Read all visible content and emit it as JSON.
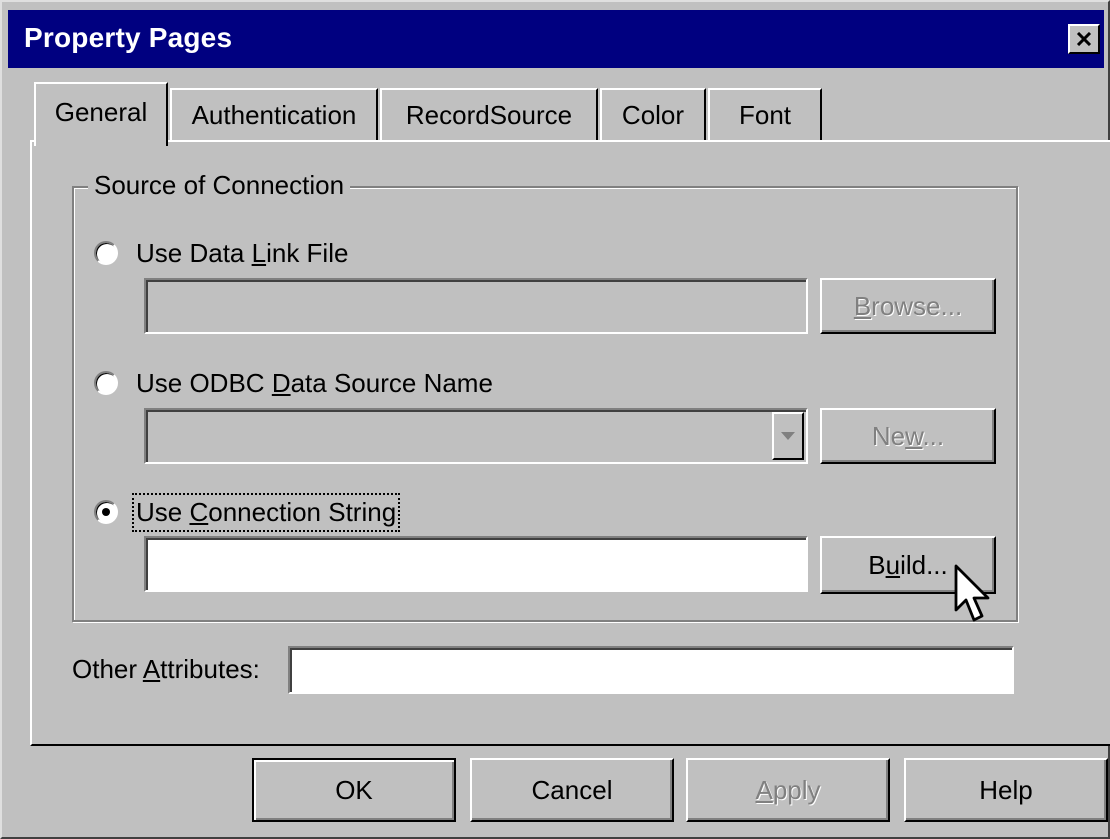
{
  "window": {
    "title": "Property Pages",
    "close_icon": "close-icon"
  },
  "tabs": [
    {
      "label": "General",
      "active": true
    },
    {
      "label": "Authentication",
      "active": false
    },
    {
      "label": "RecordSource",
      "active": false
    },
    {
      "label": "Color",
      "active": false
    },
    {
      "label": "Font",
      "active": false
    }
  ],
  "source_group": {
    "label": "Source of Connection",
    "option_data_link": {
      "pre": "Use Data ",
      "accel": "L",
      "post": "ink File",
      "selected": false,
      "field_value": "",
      "button": {
        "pre": "",
        "accel": "B",
        "post": "rowse...",
        "enabled": false
      }
    },
    "option_odbc": {
      "pre": "Use ODBC ",
      "accel": "D",
      "post": "ata Source Name",
      "selected": false,
      "field_value": "",
      "button": {
        "pre": "Ne",
        "accel": "w",
        "post": "...",
        "enabled": false
      }
    },
    "option_conn_string": {
      "pre": "Use ",
      "accel": "C",
      "post": "onnection String",
      "selected": true,
      "field_value": "",
      "button": {
        "pre": "B",
        "accel": "u",
        "post": "ild...",
        "enabled": true
      }
    }
  },
  "other_attributes": {
    "pre": "Other ",
    "accel": "A",
    "post": "ttributes:",
    "value": ""
  },
  "footer_buttons": {
    "ok": "OK",
    "cancel": "Cancel",
    "apply": {
      "pre": "",
      "accel": "A",
      "post": "pply",
      "enabled": false
    },
    "help": "Help"
  },
  "colors": {
    "titlebar": "#000080",
    "face": "#c0c0c0"
  }
}
